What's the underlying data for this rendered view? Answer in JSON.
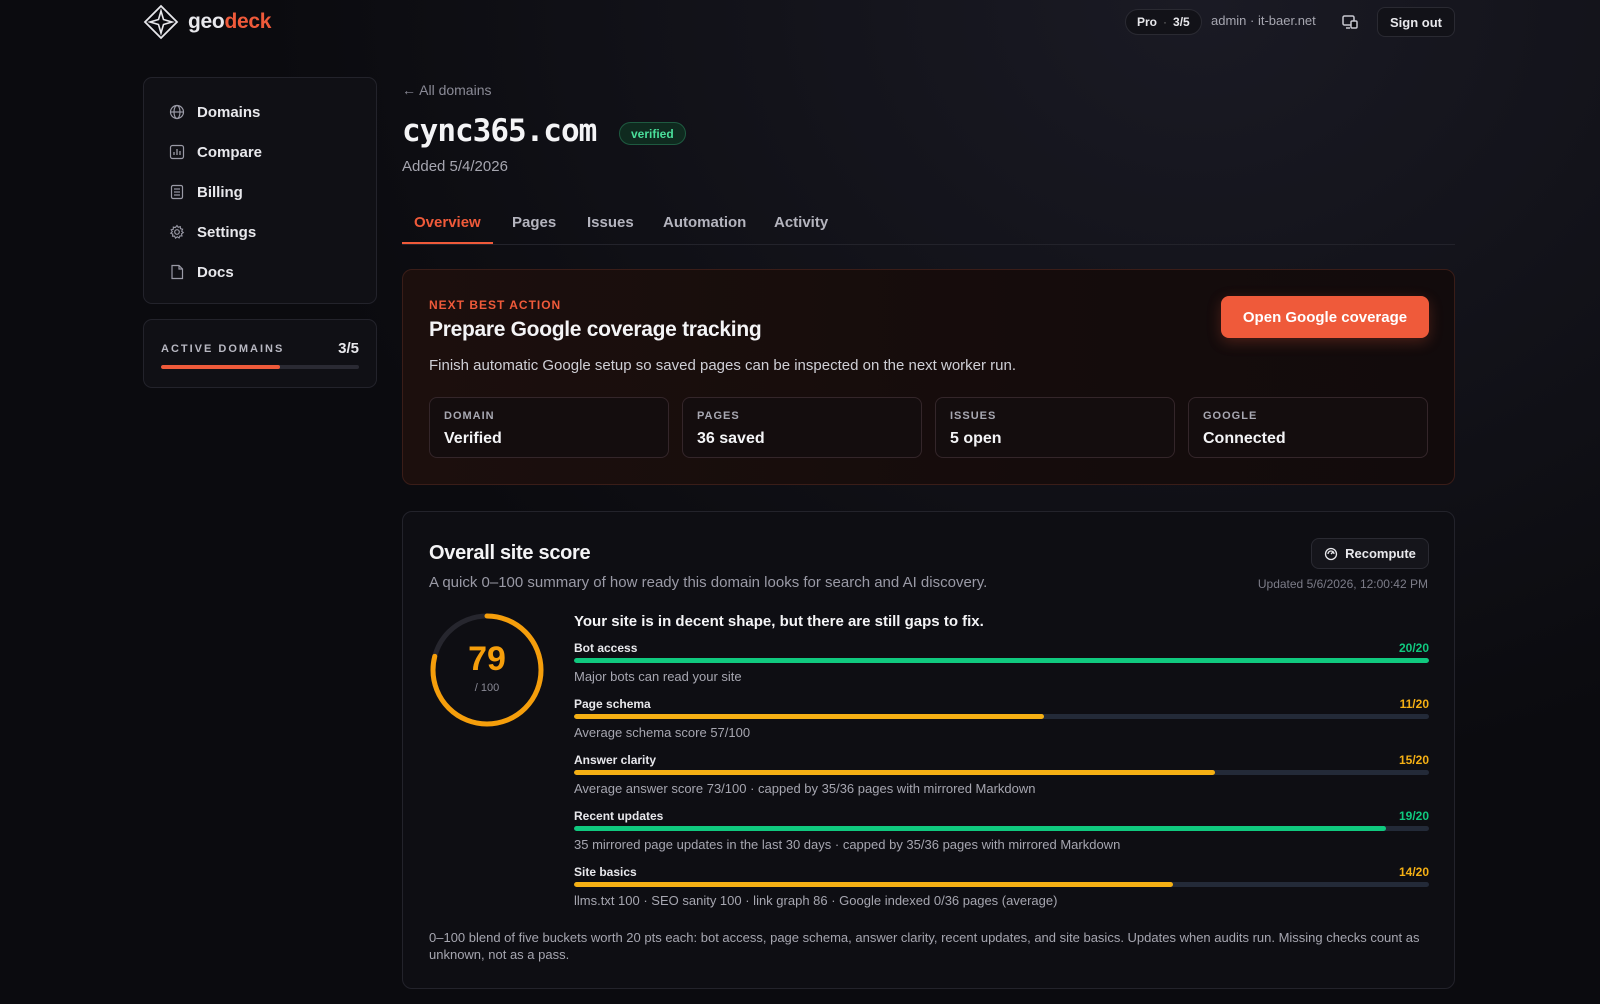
{
  "brand": {
    "name_part1": "geo",
    "name_part2": "deck"
  },
  "header": {
    "plan": "Pro",
    "plan_usage": "3/5",
    "user": "admin · it-baer.net",
    "sign_out": "Sign out"
  },
  "sidebar": {
    "items": [
      {
        "label": "Domains",
        "icon": "globe-icon"
      },
      {
        "label": "Compare",
        "icon": "chart-icon"
      },
      {
        "label": "Billing",
        "icon": "receipt-icon"
      },
      {
        "label": "Settings",
        "icon": "gear-icon"
      },
      {
        "label": "Docs",
        "icon": "document-icon"
      }
    ],
    "active_domains": {
      "label": "ACTIVE DOMAINS",
      "count": "3/5",
      "fraction": 0.6
    }
  },
  "main": {
    "back_link": "← All domains",
    "domain": "cync365.com",
    "status_badge": "verified",
    "added": "Added 5/4/2026",
    "tabs": [
      "Overview",
      "Pages",
      "Issues",
      "Automation",
      "Activity"
    ],
    "active_tab": "Overview"
  },
  "next_action": {
    "kicker": "NEXT BEST ACTION",
    "title": "Prepare Google coverage tracking",
    "description": "Finish automatic Google setup so saved pages can be inspected on the next worker run.",
    "button": "Open Google coverage",
    "stats": [
      {
        "label": "DOMAIN",
        "value": "Verified"
      },
      {
        "label": "PAGES",
        "value": "36 saved"
      },
      {
        "label": "ISSUES",
        "value": "5 open"
      },
      {
        "label": "GOOGLE",
        "value": "Connected"
      }
    ]
  },
  "site_score": {
    "title": "Overall site score",
    "subtitle": "A quick 0–100 summary of how ready this domain looks for search and AI discovery.",
    "recompute": "Recompute",
    "updated": "Updated 5/6/2026, 12:00:42 PM",
    "score": "79",
    "score_value": 79,
    "score_max": "/ 100",
    "headline": "Your site is in decent shape, but there are still gaps to fix.",
    "buckets": [
      {
        "name": "Bot access",
        "score": "20/20",
        "value": 20,
        "max": 20,
        "color": "#10c97f",
        "desc": "Major bots can read your site"
      },
      {
        "name": "Page schema",
        "score": "11/20",
        "value": 11,
        "max": 20,
        "color": "#f5b014",
        "desc": "Average schema score 57/100"
      },
      {
        "name": "Answer clarity",
        "score": "15/20",
        "value": 15,
        "max": 20,
        "color": "#f5b014",
        "desc": "Average answer score 73/100 · capped by 35/36 pages with mirrored Markdown"
      },
      {
        "name": "Recent updates",
        "score": "19/20",
        "value": 19,
        "max": 20,
        "color": "#10c97f",
        "desc": "35 mirrored page updates in the last 30 days · capped by 35/36 pages with mirrored Markdown"
      },
      {
        "name": "Site basics",
        "score": "14/20",
        "value": 14,
        "max": 20,
        "color": "#f5b014",
        "desc": "llms.txt 100 · SEO sanity 100 · link graph 86 · Google indexed 0/36 pages (average)"
      }
    ],
    "footnote": "0–100 blend of five buckets worth 20 pts each: bot access, page schema, answer clarity, recent updates, and site basics. Updates when audits run. Missing checks count as unknown, not as a pass."
  },
  "colors": {
    "accent": "#ef5a3a",
    "good": "#10c97f",
    "warn": "#f5b014",
    "ring": "#f59e0b"
  }
}
